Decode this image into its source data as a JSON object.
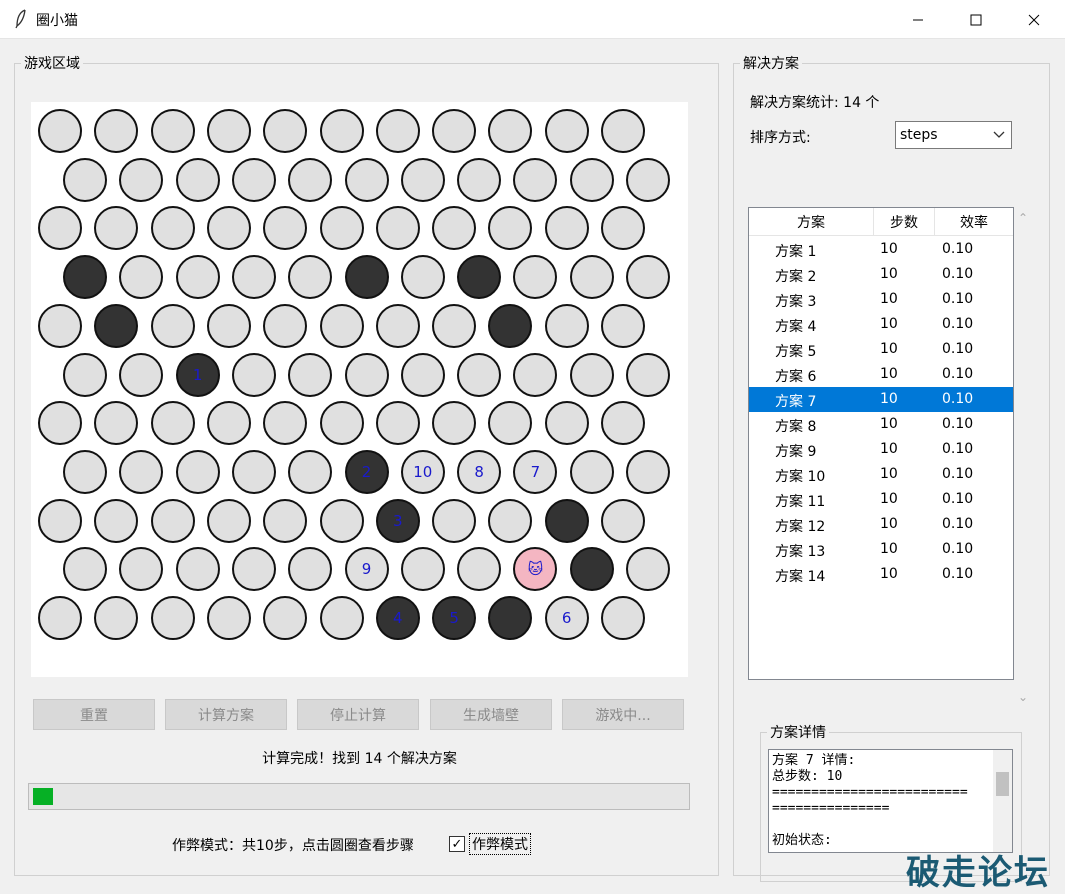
{
  "window": {
    "title": "圈小猫"
  },
  "game_area": {
    "label": "游戏区域",
    "cell_marks": {
      "0,0": "",
      "3,0": ""
    },
    "buttons": [
      "重置",
      "计算方案",
      "停止计算",
      "生成墙壁",
      "游戏中..."
    ],
    "status": "计算完成！找到 14 个解决方案",
    "progress_fraction": 0.03,
    "cheat_info": "作弊模式：共10步，点击圆圈查看步骤",
    "cheat_checkbox_label": "作弊模式",
    "cheat_checked": true
  },
  "board": {
    "rows": 11,
    "cols": 11,
    "walls": [
      [
        3,
        0
      ],
      [
        3,
        5
      ],
      [
        3,
        7
      ],
      [
        4,
        1
      ],
      [
        4,
        8
      ],
      [
        5,
        2
      ],
      [
        7,
        5
      ],
      [
        8,
        6
      ],
      [
        8,
        9
      ],
      [
        9,
        9
      ],
      [
        10,
        6
      ],
      [
        10,
        7
      ],
      [
        10,
        8
      ]
    ],
    "cat": [
      9,
      8
    ],
    "cat_emoji": "🐱",
    "labels": [
      {
        "r": 5,
        "c": 2,
        "text": "1"
      },
      {
        "r": 7,
        "c": 5,
        "text": "2"
      },
      {
        "r": 8,
        "c": 6,
        "text": "3"
      },
      {
        "r": 10,
        "c": 6,
        "text": "4"
      },
      {
        "r": 10,
        "c": 7,
        "text": "5"
      },
      {
        "r": 10,
        "c": 9,
        "text": "6"
      },
      {
        "r": 7,
        "c": 8,
        "text": "7"
      },
      {
        "r": 7,
        "c": 7,
        "text": "8"
      },
      {
        "r": 9,
        "c": 5,
        "text": "9"
      },
      {
        "r": 7,
        "c": 6,
        "text": "10"
      }
    ]
  },
  "solutions": {
    "label": "解决方案",
    "stats": "解决方案统计: 14 个",
    "sort_label": "排序方式:",
    "sort_value": "steps",
    "columns": [
      "方案",
      "步数",
      "效率"
    ],
    "rows": [
      {
        "name": "方案 1",
        "steps": "10",
        "eff": "0.10"
      },
      {
        "name": "方案 2",
        "steps": "10",
        "eff": "0.10"
      },
      {
        "name": "方案 3",
        "steps": "10",
        "eff": "0.10"
      },
      {
        "name": "方案 4",
        "steps": "10",
        "eff": "0.10"
      },
      {
        "name": "方案 5",
        "steps": "10",
        "eff": "0.10"
      },
      {
        "name": "方案 6",
        "steps": "10",
        "eff": "0.10"
      },
      {
        "name": "方案 7",
        "steps": "10",
        "eff": "0.10"
      },
      {
        "name": "方案 8",
        "steps": "10",
        "eff": "0.10"
      },
      {
        "name": "方案 9",
        "steps": "10",
        "eff": "0.10"
      },
      {
        "name": "方案 10",
        "steps": "10",
        "eff": "0.10"
      },
      {
        "name": "方案 11",
        "steps": "10",
        "eff": "0.10"
      },
      {
        "name": "方案 12",
        "steps": "10",
        "eff": "0.10"
      },
      {
        "name": "方案 13",
        "steps": "10",
        "eff": "0.10"
      },
      {
        "name": "方案 14",
        "steps": "10",
        "eff": "0.10"
      }
    ],
    "selected_row": 6,
    "selected_color": "#0078d7"
  },
  "details": {
    "label": "方案详情",
    "text": "方案 7 详情:\n总步数: 10\n=========================\n===============\n\n初始状态:"
  },
  "watermark": "破走论坛",
  "colors": {
    "wall": "#333333",
    "empty": "#e0e0e0",
    "cat": "#f4b6c2",
    "step_label": "#1a1acc",
    "progress": "#06b025"
  }
}
